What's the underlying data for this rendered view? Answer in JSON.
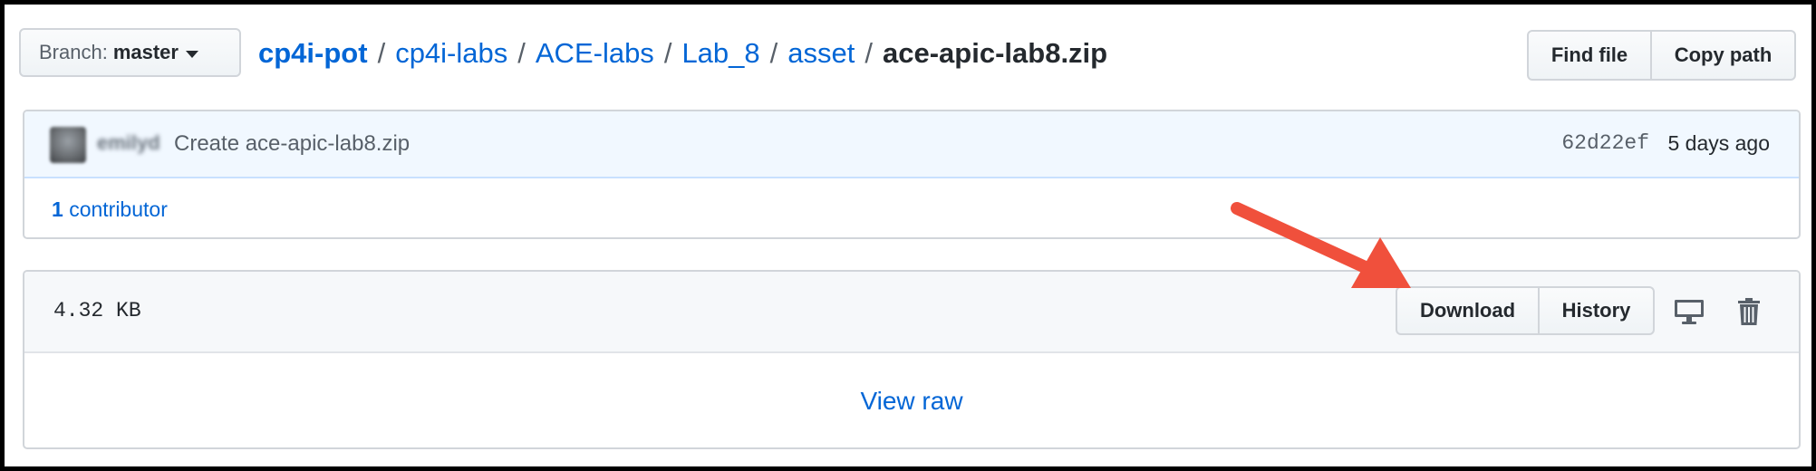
{
  "branch": {
    "prefix": "Branch:",
    "name": "master"
  },
  "breadcrumb": {
    "items": [
      "cp4i-pot",
      "cp4i-labs",
      "ACE-labs",
      "Lab_8",
      "asset"
    ],
    "separator": "/",
    "current": "ace-apic-lab8.zip"
  },
  "actions": {
    "find_file": "Find file",
    "copy_path": "Copy path"
  },
  "commit": {
    "author": "emilyd",
    "message": "Create ace-apic-lab8.zip",
    "sha": "62d22ef",
    "time": "5 days ago"
  },
  "contributors": {
    "count": "1",
    "label": "contributor"
  },
  "file": {
    "size": "4.32 KB",
    "download_label": "Download",
    "history_label": "History",
    "view_raw_label": "View raw",
    "desktop_icon": "desktop-icon",
    "delete_icon": "trash-icon"
  },
  "annotation": {
    "arrow_color": "#f0503c"
  },
  "colors": {
    "link": "#0366d6",
    "border": "#d1d5da",
    "commit_bg": "#f1f8ff",
    "file_header_bg": "#f6f8fa"
  }
}
